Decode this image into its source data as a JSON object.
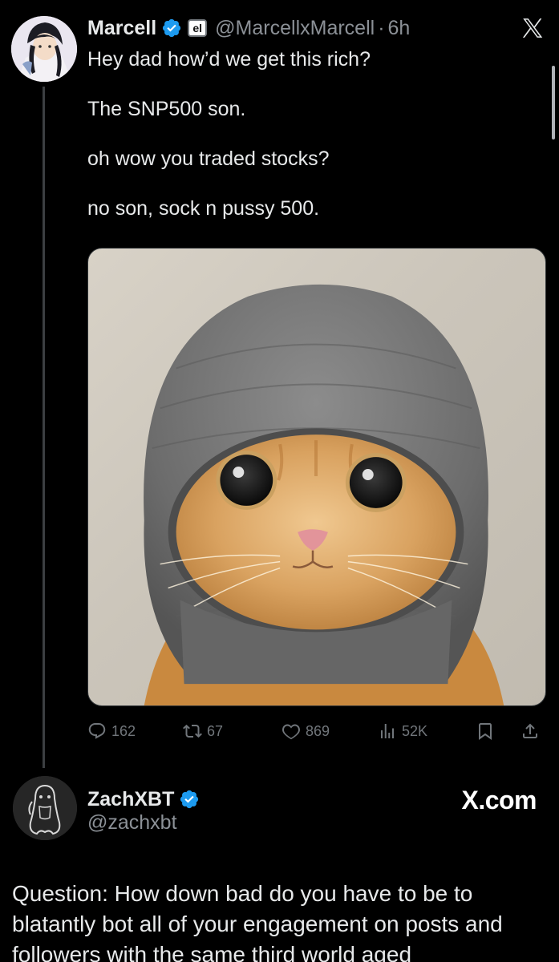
{
  "scrollbar": {
    "visible": true
  },
  "tweet1": {
    "author_name": "Marcell",
    "affiliate_badge": "el",
    "handle": "@MarcellxMarcell",
    "separator": "·",
    "time": "6h",
    "lines": [
      "Hey dad how’d we get this rich?",
      "The SNP500 son.",
      "oh wow you traded stocks?",
      "no son, sock n pussy 500."
    ],
    "media_icon": "cat-in-beanie-photo",
    "actions": {
      "replies": "162",
      "reposts": "67",
      "likes": "869",
      "views": "52K"
    },
    "icons": {
      "verified": "verified-badge-icon",
      "x_logo": "x-logo-icon",
      "reply": "reply-icon",
      "repost": "repost-icon",
      "like": "heart-icon",
      "views": "views-icon",
      "bookmark": "bookmark-icon",
      "share": "share-icon"
    }
  },
  "tweet2": {
    "author_name": "ZachXBT",
    "handle": "@zachxbt",
    "brand": "X.com",
    "text": "Question: How down bad do you have to be to blatantly bot all of your engagement on posts and followers with the same third world aged"
  },
  "colors": {
    "background": "#000000",
    "text_primary": "#e7e9ea",
    "text_secondary": "#8b9096",
    "verified_blue": "#1d9bf0"
  }
}
